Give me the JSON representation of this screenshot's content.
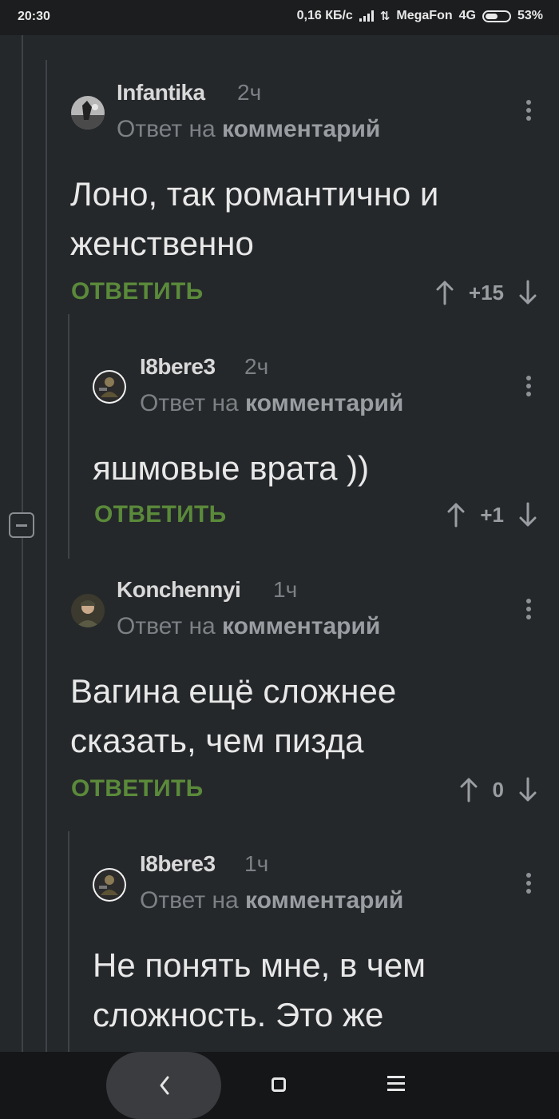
{
  "status_bar": {
    "time": "20:30",
    "network_speed": "0,16 КБ/с",
    "carrier": "MegaFon",
    "network_type": "4G",
    "battery": "53%",
    "battery_level": 0.53
  },
  "comments": [
    {
      "username": "Infantika",
      "time": "2ч",
      "reply_prefix": "Ответ на",
      "reply_target": "комментарий",
      "text_lines": [
        "Лоно, так романтично и",
        "женственно"
      ],
      "reply_label": "ОТВЕТИТЬ",
      "score": "+15"
    },
    {
      "username": "I8bere3",
      "time": "2ч",
      "reply_prefix": "Ответ на",
      "reply_target": "комментарий",
      "text_lines": [
        "яшмовые врата ))"
      ],
      "reply_label": "ОТВЕТИТЬ",
      "score": "+1"
    },
    {
      "username": "Konchennyi",
      "time": "1ч",
      "reply_prefix": "Ответ на",
      "reply_target": "комментарий",
      "text_lines": [
        "Вагина ещё сложнее",
        "сказать, чем пизда"
      ],
      "reply_label": "ОТВЕТИТЬ",
      "score": "0"
    },
    {
      "username": "I8bere3",
      "time": "1ч",
      "reply_prefix": "Ответ на",
      "reply_target": "комментарий",
      "text_lines": [
        "Не понять мне, в чем",
        "сложность. Это же"
      ]
    }
  ],
  "icons": {
    "upvote": "arrow-up-icon",
    "downvote": "arrow-down-icon",
    "more": "more-vertical-icon",
    "collapse": "collapse-thread-icon",
    "nav_back": "chevron-left-icon",
    "nav_home": "square-home-icon",
    "nav_menu": "menu-lines-icon"
  },
  "colors": {
    "background": "#25282b",
    "reply_green": "#5a8a3a",
    "muted_text": "#7d8085"
  }
}
